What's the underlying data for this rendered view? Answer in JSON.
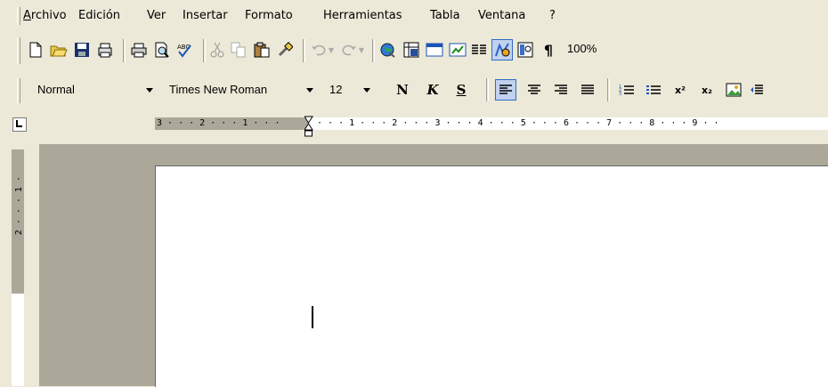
{
  "menubar": {
    "items": [
      {
        "label": "Archivo"
      },
      {
        "label": "Edición"
      },
      {
        "label": "Ver"
      },
      {
        "label": "Insertar"
      },
      {
        "label": "Formato"
      },
      {
        "label": "Herramientas"
      },
      {
        "label": "Tabla"
      },
      {
        "label": "Ventana"
      },
      {
        "label": "?"
      }
    ]
  },
  "standard_toolbar": {
    "zoom": "100%",
    "icons": [
      "new-document-icon",
      "open-folder-icon",
      "save-icon",
      "permission-icon",
      "print-icon",
      "print-preview-icon",
      "spelling-icon",
      "cut-icon",
      "copy-icon",
      "paste-icon",
      "format-painter-icon",
      "undo-icon",
      "redo-icon",
      "hyperlink-icon",
      "tables-borders-icon",
      "insert-table-icon",
      "insert-excel-icon",
      "columns-icon",
      "drawing-icon",
      "document-map-icon",
      "show-formatting-icon"
    ]
  },
  "formatting_toolbar": {
    "style": "Normal",
    "font": "Times New Roman",
    "size": "12",
    "bold": "N",
    "italic": "K",
    "underline": "S",
    "superscript": "x²",
    "subscript": "x₂"
  },
  "ruler": {
    "labels": "3 · · · 2 · · · 1 · · ·",
    "labels_right": "· · · 1 · · · 2 · · · 3 · · · 4 · · · 5 · · · 6 · · · 7 · · · 8 · · · 9 · ·",
    "vertical_labels": "2 · · · 1 ·"
  },
  "colors": {
    "chrome": "#ece9d8",
    "page": "#ffffff",
    "docbg": "#aca899",
    "active": "#c1d2ee"
  }
}
